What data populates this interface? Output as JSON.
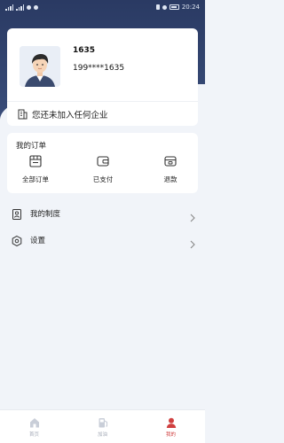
{
  "status_bar": {
    "time": "20:24"
  },
  "profile": {
    "name": "1635",
    "phone": "199****1635",
    "company_notice": "您还未加入任何企业"
  },
  "orders": {
    "title": "我的订单",
    "items": [
      {
        "label": "全部订单",
        "icon": "order-list-icon"
      },
      {
        "label": "已支付",
        "icon": "wallet-icon"
      },
      {
        "label": "退款",
        "icon": "refund-icon"
      }
    ]
  },
  "menu": [
    {
      "label": "我的制度",
      "icon": "regulation-icon"
    },
    {
      "label": "设置",
      "icon": "gear-icon"
    }
  ],
  "tabbar": [
    {
      "label": "首页",
      "icon": "home-icon",
      "active": false
    },
    {
      "label": "加油",
      "icon": "fuel-icon",
      "active": false
    },
    {
      "label": "我的",
      "icon": "profile-icon",
      "active": true
    }
  ],
  "colors": {
    "hero": "#2a3a63",
    "active_tab": "#d04040",
    "inactive_tab": "#a6acb8"
  }
}
